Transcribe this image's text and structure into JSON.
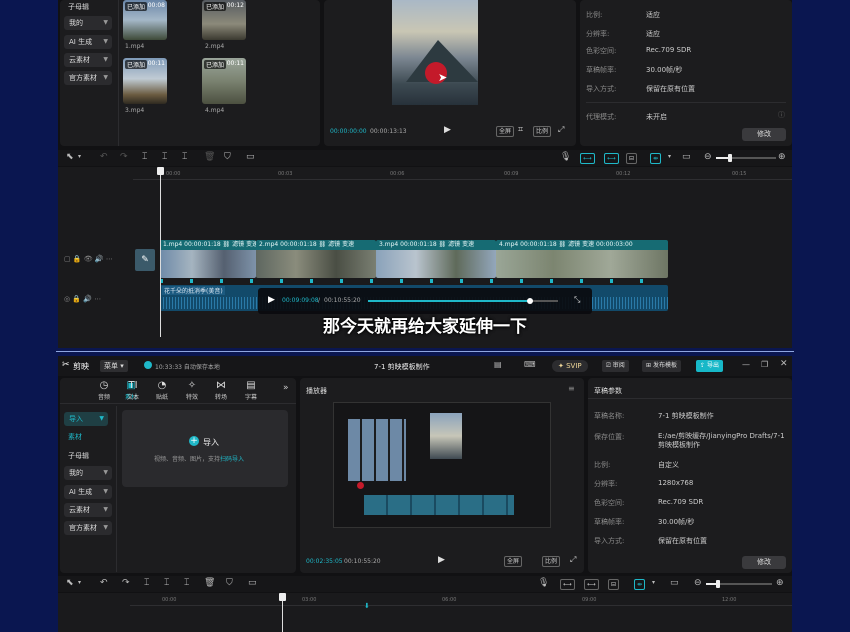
{
  "top": {
    "sidebar": {
      "partial_label": "子母辑",
      "items": [
        "我的",
        "AI 生成",
        "云素材",
        "官方素材"
      ]
    },
    "media": [
      {
        "name": "1.mp4",
        "tag": "已添加",
        "duration": "00:08"
      },
      {
        "name": "2.mp4",
        "tag": "已添加",
        "duration": "00:12"
      },
      {
        "name": "3.mp4",
        "tag": "已添加",
        "duration": "00:11"
      },
      {
        "name": "4.mp4",
        "tag": "已添加",
        "duration": "00:11"
      }
    ],
    "player": {
      "current_time": "00:00:00:00",
      "total_time": "00:00:13:13",
      "btn_fit": "全屏",
      "btn_ratio": "比例"
    },
    "props": {
      "rows": [
        {
          "k": "比例:",
          "v": "适应"
        },
        {
          "k": "分辨率:",
          "v": "适应"
        },
        {
          "k": "色彩空间:",
          "v": "Rec.709 SDR"
        },
        {
          "k": "草稿帧率:",
          "v": "30.00帧/秒"
        },
        {
          "k": "导入方式:",
          "v": "保留在原有位置"
        },
        {
          "k": "代理模式:",
          "v": "未开启"
        }
      ],
      "edit_button": "修改"
    },
    "timeline": {
      "ruler": [
        "00:00",
        "00:03",
        "00:06",
        "00:09",
        "00:12",
        "00:15"
      ],
      "clips": [
        {
          "name": "1.mp4",
          "time": "00:00:01:18"
        },
        {
          "name": "2.mp4",
          "time": "00:00:01:18"
        },
        {
          "name": "3.mp4",
          "time": "00:00:01:18"
        },
        {
          "name": "4.mp4",
          "time": "00:00:01:18"
        }
      ],
      "clip_tag_filter": "滤镜",
      "clip_tag_speed": "变速",
      "last_clip_time": "00:00:03:00",
      "audio_label": "花千朵的抵消季(美音)"
    },
    "video_overlay": {
      "current": "00:09:09:08",
      "total": "00:10:55:20"
    },
    "subtitle": "那今天就再给大家延伸一下"
  },
  "bottom": {
    "titlebar": {
      "app_name": "剪映",
      "menu": "菜单",
      "autosave": "10:33:33 自动保存本地",
      "project": "7-1 剪映模板制作",
      "svip": "SVIP",
      "review": "审阅",
      "publish": "发布模板",
      "export": "导出"
    },
    "tabs": [
      "素材",
      "音频",
      "文本",
      "贴纸",
      "特效",
      "转场",
      "字幕"
    ],
    "sidebar": {
      "import": "导入",
      "items_plain": [
        "素材",
        "子母辑"
      ],
      "items": [
        "我的",
        "AI 生成",
        "云素材",
        "官方素材"
      ]
    },
    "import_area": {
      "title": "导入",
      "hint": "视频、音频、图片，支持",
      "hint_link": "扫码导入"
    },
    "player": {
      "title": "播放器",
      "current_time": "00:02:35:05",
      "total_time": "00:10:55:20",
      "btn_fit": "全屏",
      "btn_ratio": "比例"
    },
    "props": {
      "title": "草稿参数",
      "rows": [
        {
          "k": "草稿名称:",
          "v": "7-1 剪映模板制作"
        },
        {
          "k": "保存位置:",
          "v": "E:/ae/剪映缓存/JianyingPro Drafts/7-1 剪映模板制作"
        },
        {
          "k": "比例:",
          "v": "自定义"
        },
        {
          "k": "分辨率:",
          "v": "1280x768"
        },
        {
          "k": "色彩空间:",
          "v": "Rec.709 SDR"
        },
        {
          "k": "草稿帧率:",
          "v": "30.00帧/秒"
        },
        {
          "k": "导入方式:",
          "v": "保留在原有位置"
        }
      ],
      "edit_button": "修改"
    },
    "timeline": {
      "ruler": [
        "00:00",
        "03:00",
        "06:00",
        "09:00",
        "12:00"
      ]
    }
  },
  "colors": {
    "background": "#0a1650",
    "panel": "#1c1c1e",
    "accent": "#1fb8c8",
    "export": "#17b8c8",
    "clip_head": "#166b73",
    "record": "#c41a2a"
  }
}
